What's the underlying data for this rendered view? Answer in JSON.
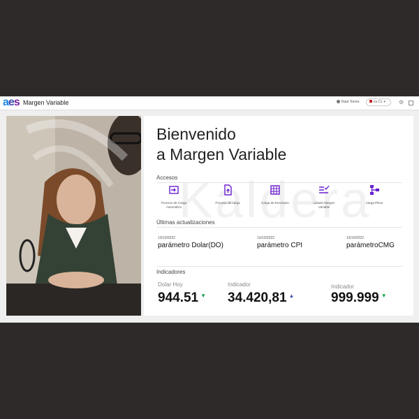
{
  "header": {
    "app_title": "Margen Variable",
    "user_name": "Raul Torres",
    "language": "es-CL"
  },
  "photo": {
    "description_icon": "photo-woman-office"
  },
  "welcome": {
    "line1": "Bienvenido",
    "line2": "a Margen Variable"
  },
  "watermark": "Kaldera",
  "accesos": {
    "title": "Accesos",
    "items": [
      {
        "label": "Proceso de Carga Automático",
        "icon": "import-icon"
      },
      {
        "label": "Proceso de carga",
        "icon": "file-upload-icon"
      },
      {
        "label": "Carga de Escenario",
        "icon": "table-icon"
      },
      {
        "label": "Listado Margen Variable",
        "icon": "checklist-icon"
      },
      {
        "label": "Carga Plexo",
        "icon": "hierarchy-icon"
      }
    ]
  },
  "updates": {
    "title": "Últimas actualizaciones",
    "items": [
      {
        "date": "13/10/2022",
        "name": "parámetro Dolar(DO)"
      },
      {
        "date": "13/10/2022",
        "name": "parámetro CPI"
      },
      {
        "date": "13/10/2022",
        "name": "parámetroCMG"
      }
    ]
  },
  "indicators": {
    "title": "Indicadores",
    "items": [
      {
        "label": "Dolar Hoy",
        "value": "944.51",
        "trend": "down"
      },
      {
        "label": "Indicador",
        "value": "34.420,81",
        "trend": "up"
      },
      {
        "label": "Indicador",
        "value": "999.999",
        "trend": "down"
      }
    ]
  },
  "colors": {
    "accent": "#6a1fd0",
    "up": "#3f51b5",
    "down": "#16a34a"
  }
}
